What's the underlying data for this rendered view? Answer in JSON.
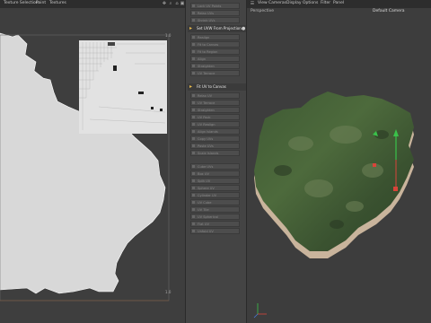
{
  "uv_editor": {
    "menu": [
      "Texture Selection",
      "Paint",
      "Textures"
    ],
    "corner_top": "1.0",
    "corner_bottom": "1.0"
  },
  "commands": {
    "group1": [
      "Lock UV Points",
      "Relax UVs",
      "Shrink UVs",
      "Grow UVs",
      "Mirror UVs"
    ],
    "header_project": "Set UVW From Projection...",
    "group2": [
      "Realign",
      "Fit to Canvas",
      "Fit to Region",
      "Align",
      "Straighten",
      "UV Terrace",
      "Equalize UV Islands",
      "Scale Islands"
    ],
    "header_camera": "Fit UV to Canvas",
    "group3": [
      "Relax UV",
      "UV Terrace",
      "Straighten",
      "UV Pack",
      "UV Realign",
      "Align Islands",
      "Copy UVs",
      "Paste UVs",
      "Scale Islands"
    ],
    "group4": [
      "Cube UVs",
      "Box UV",
      "Split UV",
      "Sphere UV",
      "Cylinder UV",
      "UV Cube",
      "UV Tile",
      "UV Spherical",
      "Flat UV",
      "Unfold UV",
      "Relax UVs"
    ]
  },
  "viewport": {
    "menu": [
      "View",
      "Cameras",
      "Display",
      "Options",
      "Filter",
      "Panel"
    ],
    "title": "Perspective",
    "camera": "Default Camera"
  }
}
